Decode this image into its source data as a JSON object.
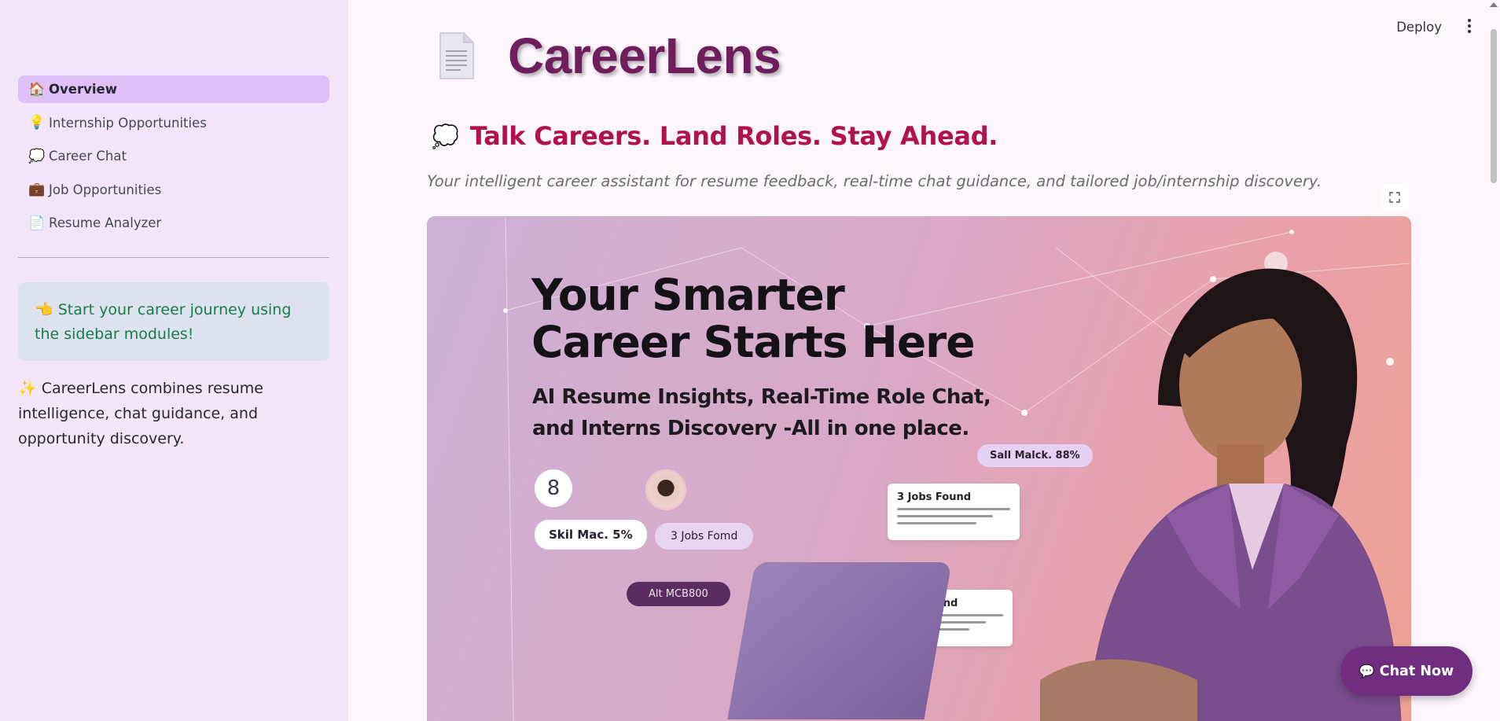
{
  "sidebar": {
    "items": [
      {
        "icon": "🏠",
        "label": "Overview",
        "active": true
      },
      {
        "icon": "💡",
        "label": "Internship Opportunities"
      },
      {
        "icon": "💭",
        "label": "Career Chat"
      },
      {
        "icon": "💼",
        "label": "Job Opportunities"
      },
      {
        "icon": "📄",
        "label": "Resume Analyzer"
      }
    ],
    "info_box": {
      "icon": "👈",
      "text": "Start your career journey using the sidebar modules!"
    },
    "description": {
      "icon": "✨",
      "text": "CareerLens combines resume intelligence, chat guidance, and opportunity discovery."
    }
  },
  "header": {
    "deploy_label": "Deploy"
  },
  "main": {
    "title": "CareerLens",
    "tagline_icon": "💭",
    "tagline": "Talk Careers. Land Roles. Stay Ahead.",
    "subtitle": "Your intelligent career assistant for resume feedback, real-time chat guidance, and tailored job/internship discovery."
  },
  "hero": {
    "headline_line1": "Your Smarter",
    "headline_line2": "Career Starts Here",
    "subhead_line1": "AI Resume Insights, Real-Time Role Chat,",
    "subhead_line2": "and Interns Discovery -All in one place.",
    "badge_number": "8",
    "chip_skill_left": "Skil Mac. 5%",
    "chip_jobs_left": "3 Jobs Fomd",
    "chip_button": "Alt MCB800",
    "chip_skill_right": "Sall Malck. 88%",
    "card1_title": "3 Jobs Found",
    "card2_title": "3 Job Found"
  },
  "chat_button": {
    "icon": "💬",
    "label": "Chat Now"
  },
  "colors": {
    "sidebar_bg": "#f3e6fb",
    "active_item": "#dfc0f7",
    "title": "#6e1e5d",
    "tagline": "#b0124f",
    "chat_button": "#6e2d7f"
  }
}
